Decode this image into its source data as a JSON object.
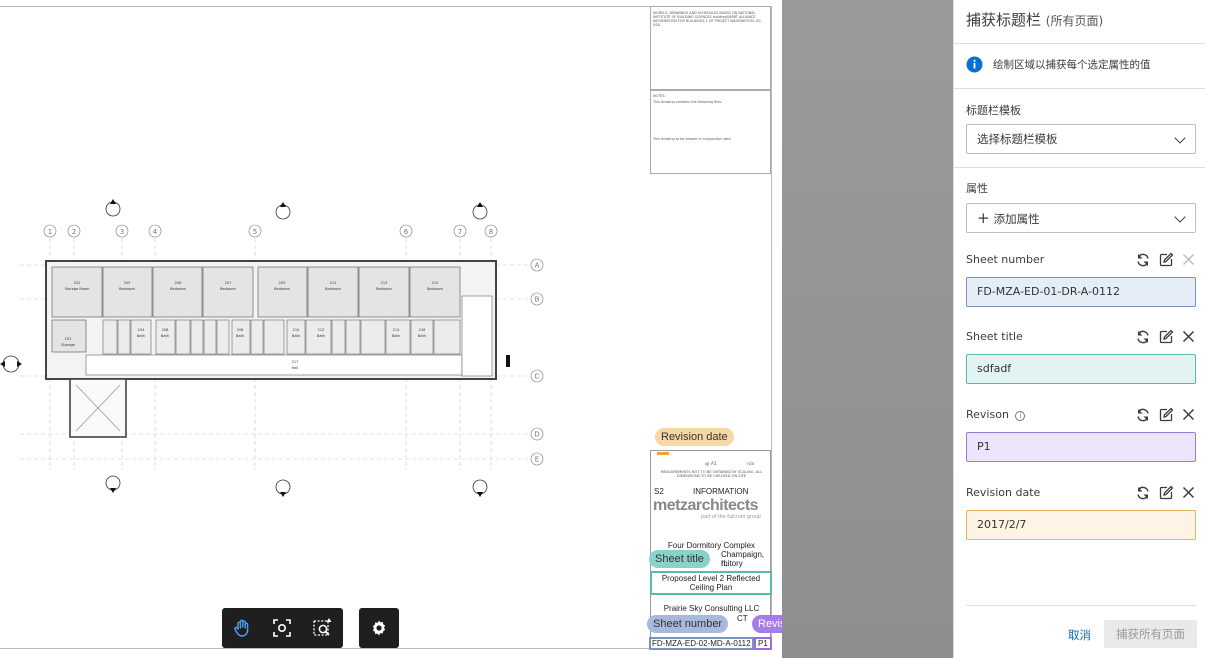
{
  "panel": {
    "title": "捕获标题栏",
    "title_suffix": "(所有页面)",
    "info_text": "绘制区域以捕获每个选定属性的值",
    "template_section_label": "标题栏模板",
    "template_select_placeholder": "选择标题栏模板",
    "properties_section_label": "属性",
    "add_property_label": "添加属性",
    "properties": [
      {
        "label": "Sheet number",
        "value": "FD-MZA-ED-01-DR-A-0112",
        "color": "#e7edf7",
        "border": "#7a92bf",
        "remove_disabled": true,
        "has_info": false
      },
      {
        "label": "Sheet title",
        "value": "sdfadf",
        "color": "#e3f3f1",
        "border": "#55b9ad",
        "remove_disabled": false,
        "has_info": false
      },
      {
        "label": "Revison",
        "value": "P1",
        "color": "#ece5fb",
        "border": "#9b7bd8",
        "remove_disabled": false,
        "has_info": true
      },
      {
        "label": "Revision date",
        "value": "2017/2/7",
        "color": "#fdf4e6",
        "border": "#e7b56a",
        "remove_disabled": false,
        "has_info": false
      }
    ],
    "cancel_label": "取消",
    "capture_label": "捕获所有页面"
  },
  "canvas": {
    "tags": {
      "revision_date": "Revision date",
      "sheet_title": "Sheet title",
      "sheet_number": "Sheet number",
      "revision": "Revison"
    },
    "tag_colors": {
      "revision_date": "#f6d7a6",
      "sheet_title": "#8ad2c8",
      "sheet_number": "#a9b9de",
      "revision": "#a77ce8"
    },
    "titleblock": {
      "sheet_number_value": "FD-MZA-ED-02-MD-A-0112",
      "revision_value": "P1",
      "sheet_title_value": "Proposed Level 2 Reflected Ceiling Plan",
      "company": "metzarchitects",
      "company_sub": "part of the fulcrum group",
      "project_line1": "Four Dormitory Complex",
      "project_line2": "Champaign, IL",
      "project_line3": "mitory",
      "client": "Prairie Sky Consulting LLC",
      "client_line2": "CT",
      "info": "INFORMATION",
      "status": "S2",
      "scale": "@ A1",
      "scale_na": "n/a",
      "measure_note": "MEASUREMENTS NOT TO BE OBTAINED BY SCALING. ALL DIMENSIONS TO BE CHECKED ON SITE",
      "top_note": "MODELS, DRAWINGS AND SCHEDULES BASED ON NATIONAL INSTITUTE OF BUILDING SCIENCES buildingSMART ALLIANCE INFORMATION FOR BUILDINGS 1 OF PROJECT WASHINGTON, DC, USA",
      "notes_head": "NOTES:",
      "notes_1": "This drawing contains the following files.",
      "notes_2": "This drawing to be viewed in conjunction with"
    },
    "plan": {
      "grid_numbers": [
        "1",
        "2",
        "3",
        "4",
        "5",
        "6",
        "7",
        "8"
      ],
      "grid_letters": [
        "A",
        "B",
        "C",
        "D",
        "E"
      ],
      "rooms": [
        {
          "num": "202",
          "name": "Storage Room"
        },
        {
          "num": "205",
          "name": "Bedroom"
        },
        {
          "num": "206",
          "name": "Bedroom"
        },
        {
          "num": "207",
          "name": "Bedroom"
        },
        {
          "num": "209",
          "name": "Bedroom"
        },
        {
          "num": "211",
          "name": "Bedroom"
        },
        {
          "num": "213",
          "name": "Bedroom"
        },
        {
          "num": "215",
          "name": "Bedroom"
        }
      ],
      "baths": [
        {
          "num": "204",
          "name": "Bath"
        },
        {
          "num": "208",
          "name": "Bath"
        },
        {
          "num": "208",
          "name": "Bath"
        },
        {
          "num": "210",
          "name": "Bath"
        },
        {
          "num": "212",
          "name": "Bath"
        },
        {
          "num": "214",
          "name": "Bath"
        },
        {
          "num": "216",
          "name": "Bath"
        }
      ],
      "storage": {
        "num": "201",
        "name": "Storage"
      },
      "hall": {
        "num": "217",
        "name": "Hall"
      }
    }
  }
}
